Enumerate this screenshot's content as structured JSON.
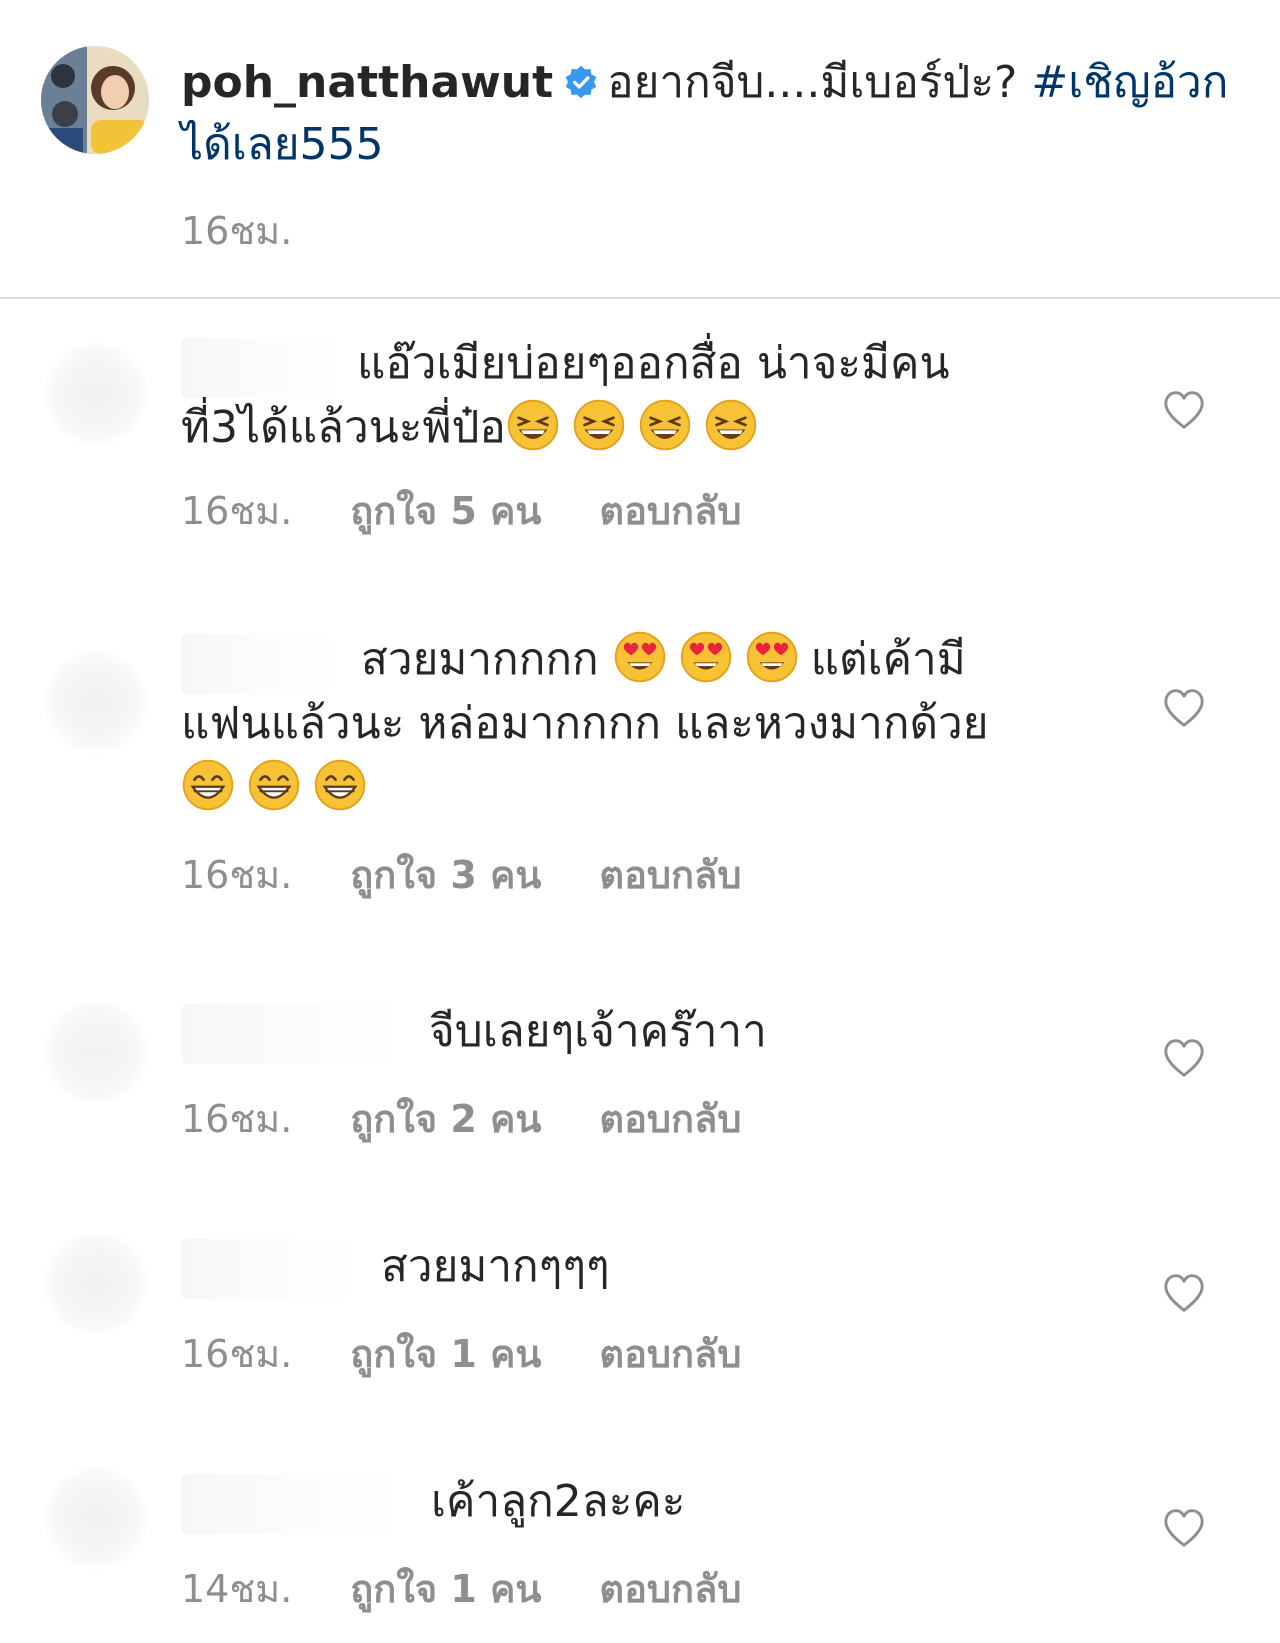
{
  "post": {
    "username": "poh_natthawut",
    "caption_text": "อยากจีบ....มีเบอร์ป่ะ?",
    "hashtag": "#เชิญอ้วกได้เลย555",
    "time": "16ชม."
  },
  "comments": [
    {
      "text": "แอ๊วเมียบ่อยๆออกสื่อ น่าจะมีคนที่3ได้แล้วนะพี่ป๋อ",
      "emoji": [
        "laughing-emoji",
        "laughing-emoji",
        "laughing-emoji",
        "laughing-emoji"
      ],
      "time": "16ชม.",
      "likes": "ถูกใจ 5 คน",
      "reply": "ตอบกลับ"
    },
    {
      "text_part1": "สวยมากกกก",
      "text_part2": "แต่เค้ามีแฟนแล้วนะ  หล่อมากกกก และหวงมากด้วย",
      "emoji_mid": [
        "heart-eyes-emoji",
        "heart-eyes-emoji",
        "heart-eyes-emoji"
      ],
      "emoji_end": [
        "grinning-emoji",
        "grinning-emoji",
        "grinning-emoji"
      ],
      "time": "16ชม.",
      "likes": "ถูกใจ 3 คน",
      "reply": "ตอบกลับ"
    },
    {
      "text": "จีบเลยๆเจ้าคร๊าาา",
      "time": "16ชม.",
      "likes": "ถูกใจ 2 คน",
      "reply": "ตอบกลับ"
    },
    {
      "text": "สวยมากๆๆๆ",
      "time": "16ชม.",
      "likes": "ถูกใจ 1 คน",
      "reply": "ตอบกลับ"
    },
    {
      "text": "เค้าลูก2ละคะ",
      "time": "14ชม.",
      "likes": "ถูกใจ 1 คน",
      "reply": "ตอบกลับ"
    }
  ],
  "icons": {
    "verified": "verified-badge-icon",
    "like": "heart-outline-icon"
  },
  "colors": {
    "text": "#262626",
    "secondary": "#8e8e8e",
    "hashtag": "#003569",
    "verified": "#3897f0",
    "divider": "#dbdbdb"
  }
}
